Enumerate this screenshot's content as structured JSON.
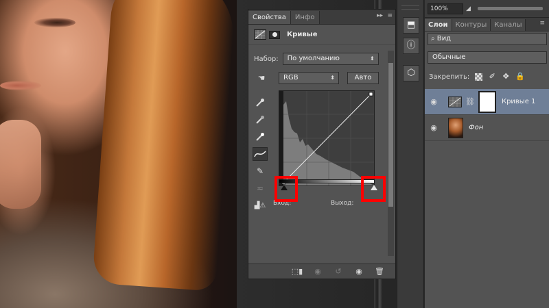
{
  "properties_panel": {
    "tabs": [
      {
        "label": "Свойства",
        "active": true
      },
      {
        "label": "Инфо",
        "active": false
      }
    ],
    "collapse_glyph": "▸▸",
    "menu_glyph": "≡",
    "title": "Кривые",
    "preset_label": "Набор:",
    "preset_value": "По умолчанию",
    "channel_value": "RGB",
    "auto_button": "Авто",
    "input_label": "Вход:",
    "output_label": "Выход:"
  },
  "layers_panel": {
    "zoom": "100%",
    "tabs": [
      {
        "label": "Слои",
        "active": true
      },
      {
        "label": "Контуры",
        "active": false
      },
      {
        "label": "Каналы",
        "active": false
      }
    ],
    "kind_filter": "⌕ Вид",
    "blend_mode": "Обычные",
    "lock_label": "Закрепить:",
    "layers": [
      {
        "name": "Кривые 1",
        "selected": true,
        "visible": true
      },
      {
        "name": "Фон",
        "selected": false,
        "visible": true
      }
    ]
  },
  "icons": {
    "strip": [
      "history-icon",
      "info-icon",
      "3d-icon"
    ],
    "tools": [
      "on-image-adjust-icon",
      "black-eyedropper-icon",
      "gray-eyedropper-icon",
      "white-eyedropper-icon",
      "curve-point-icon",
      "pencil-draw-icon",
      "smooth-icon",
      "clipping-warning-icon"
    ],
    "footer": [
      "clip-to-layer-icon",
      "view-previous-icon",
      "reset-icon",
      "visibility-icon",
      "delete-icon"
    ]
  },
  "colors": {
    "panel_bg": "#535353",
    "selected_layer": "#6f7f97",
    "highlight_box": "#ff0000"
  }
}
